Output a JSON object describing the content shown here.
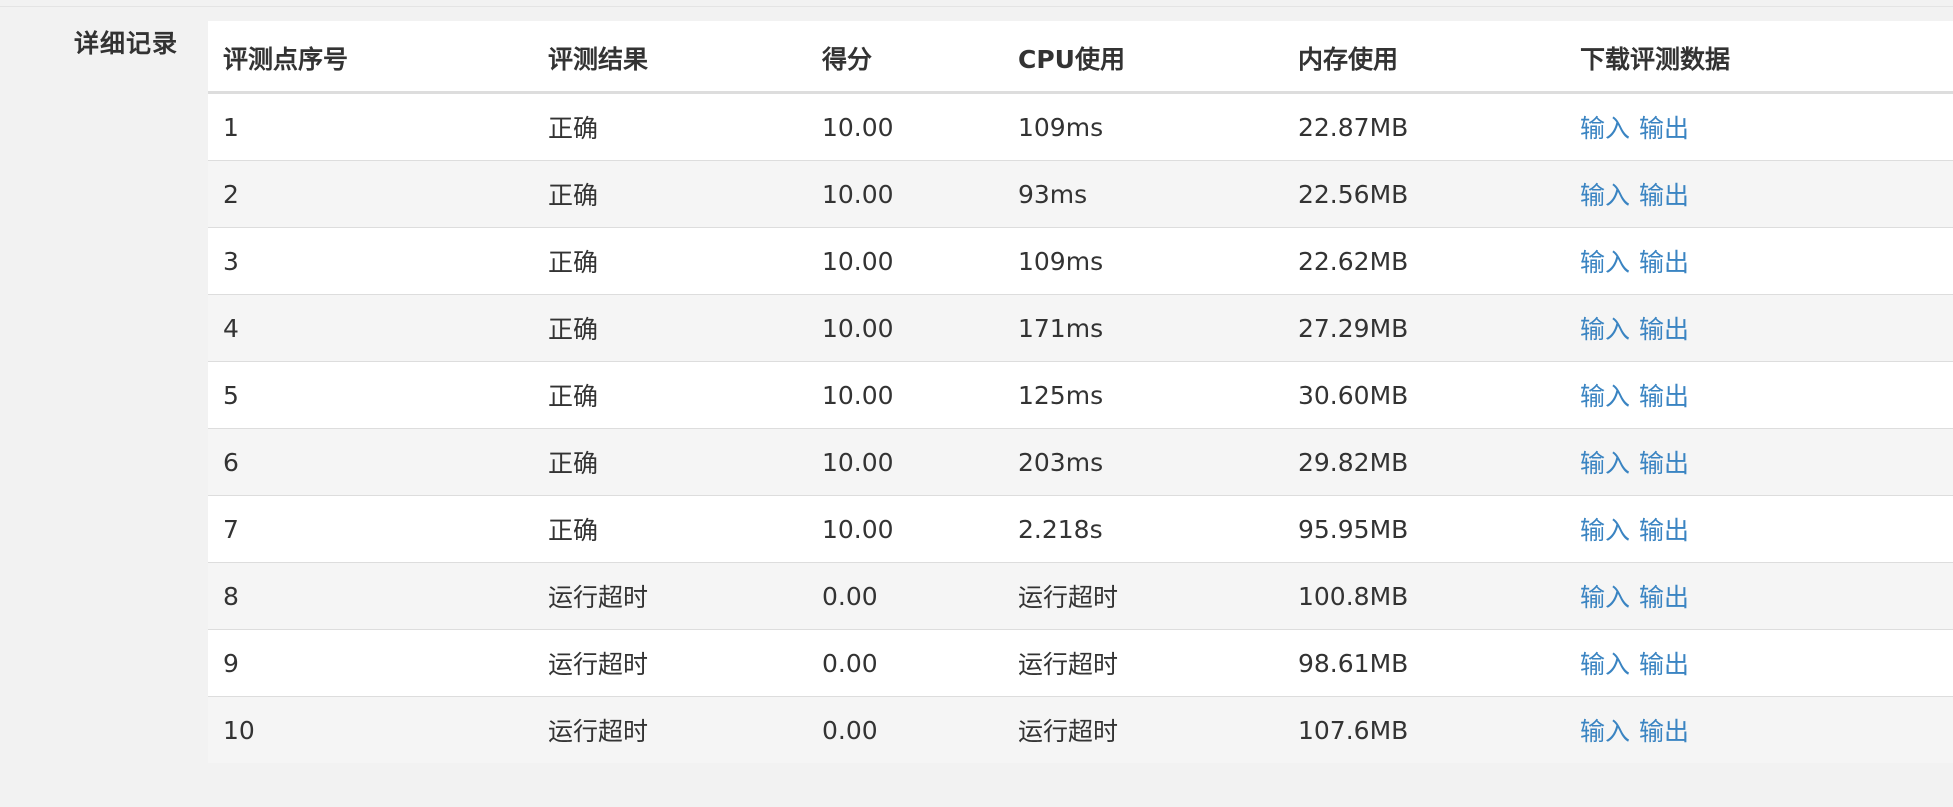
{
  "section_label": "详细记录",
  "columns": [
    "评测点序号",
    "评测结果",
    "得分",
    "CPU使用",
    "内存使用",
    "下载评测数据"
  ],
  "download_links": {
    "input": "输入",
    "output": "输出"
  },
  "rows": [
    {
      "index": "1",
      "result": "正确",
      "score": "10.00",
      "cpu": "109ms",
      "memory": "22.87MB"
    },
    {
      "index": "2",
      "result": "正确",
      "score": "10.00",
      "cpu": "93ms",
      "memory": "22.56MB"
    },
    {
      "index": "3",
      "result": "正确",
      "score": "10.00",
      "cpu": "109ms",
      "memory": "22.62MB"
    },
    {
      "index": "4",
      "result": "正确",
      "score": "10.00",
      "cpu": "171ms",
      "memory": "27.29MB"
    },
    {
      "index": "5",
      "result": "正确",
      "score": "10.00",
      "cpu": "125ms",
      "memory": "30.60MB"
    },
    {
      "index": "6",
      "result": "正确",
      "score": "10.00",
      "cpu": "203ms",
      "memory": "29.82MB"
    },
    {
      "index": "7",
      "result": "正确",
      "score": "10.00",
      "cpu": "2.218s",
      "memory": "95.95MB"
    },
    {
      "index": "8",
      "result": "运行超时",
      "score": "0.00",
      "cpu": "运行超时",
      "memory": "100.8MB"
    },
    {
      "index": "9",
      "result": "运行超时",
      "score": "0.00",
      "cpu": "运行超时",
      "memory": "98.61MB"
    },
    {
      "index": "10",
      "result": "运行超时",
      "score": "0.00",
      "cpu": "运行超时",
      "memory": "107.6MB"
    }
  ],
  "colors": {
    "link": "#3a84c2",
    "stripe": "#f5f5f5",
    "page_bg": "#f2f2f2"
  }
}
